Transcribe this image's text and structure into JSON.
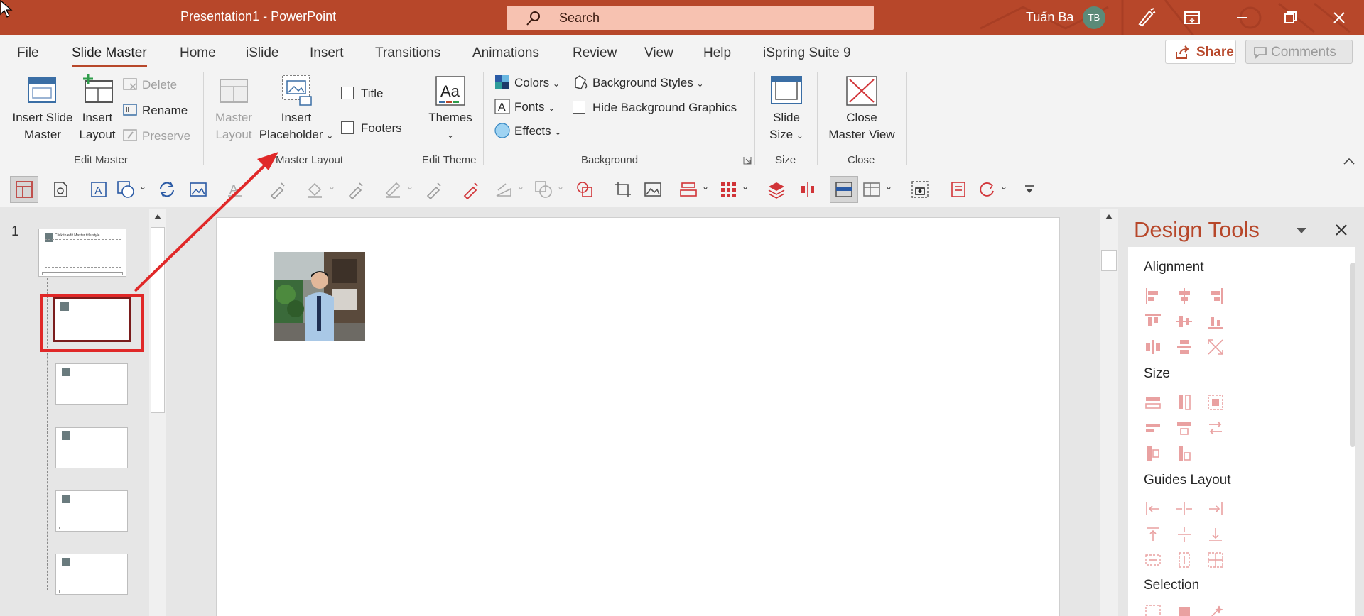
{
  "titlebar": {
    "title": "Presentation1  -  PowerPoint",
    "search_placeholder": "Search",
    "user_name": "Tuấn Ba",
    "user_initials": "TB"
  },
  "tabs": [
    {
      "label": "File"
    },
    {
      "label": "Slide Master",
      "active": true
    },
    {
      "label": "Home"
    },
    {
      "label": "iSlide"
    },
    {
      "label": "Insert"
    },
    {
      "label": "Transitions"
    },
    {
      "label": "Animations"
    },
    {
      "label": "Review"
    },
    {
      "label": "View"
    },
    {
      "label": "Help"
    },
    {
      "label": "iSpring Suite 9"
    }
  ],
  "share_label": "Share",
  "comments_label": "Comments",
  "ribbon": {
    "edit_master": {
      "label": "Edit Master",
      "insert_slide_master": [
        "Insert Slide",
        "Master"
      ],
      "insert_layout": [
        "Insert",
        "Layout"
      ],
      "delete": "Delete",
      "rename": "Rename",
      "preserve": "Preserve"
    },
    "master_layout": {
      "label": "Master Layout",
      "master_layout_btn": [
        "Master",
        "Layout"
      ],
      "insert_placeholder": [
        "Insert",
        "Placeholder"
      ],
      "title": "Title",
      "footers": "Footers"
    },
    "edit_theme": {
      "label": "Edit Theme",
      "themes": "Themes"
    },
    "background": {
      "label": "Background",
      "colors": "Colors",
      "fonts": "Fonts",
      "effects": "Effects",
      "background_styles": "Background Styles",
      "hide_background_graphics": "Hide Background Graphics"
    },
    "size": {
      "label": "Size",
      "slide_size": [
        "Slide",
        "Size"
      ]
    },
    "close": {
      "label": "Close",
      "close_master_view": [
        "Close",
        "Master View"
      ]
    }
  },
  "thumbnails": {
    "slide_number": "1",
    "master_title": "Click to edit Master title style",
    "selected_index": 1
  },
  "design_tools": {
    "title": "Design Tools",
    "sections": [
      "Alignment",
      "Size",
      "Guides Layout",
      "Selection"
    ]
  },
  "colors": {
    "accent": "#b7472a",
    "annotation": "#e02828",
    "selection": "#7a1c1c"
  }
}
